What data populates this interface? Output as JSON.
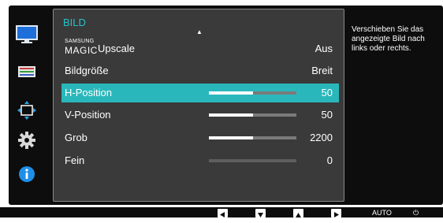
{
  "menu": {
    "title": "BILD",
    "items": [
      {
        "brand_small": "SAMSUNG",
        "brand_big": "MAGIC",
        "label": "Upscale",
        "value": "Aus"
      },
      {
        "label": "Bildgröße",
        "value": "Breit"
      },
      {
        "label": "H-Position",
        "value": "50",
        "level": 0.5,
        "selected": true
      },
      {
        "label": "V-Position",
        "value": "50",
        "level": 0.5
      },
      {
        "label": "Grob",
        "value": "2200",
        "level": 0.5
      },
      {
        "label": "Fein",
        "value": "0",
        "level": 0
      }
    ]
  },
  "sidebar": {
    "icons": [
      "monitor-icon",
      "color-bars-icon",
      "position-arrows-icon",
      "gear-icon",
      "info-icon"
    ],
    "active": "monitor-icon"
  },
  "help": {
    "text": "Verschieben Sie das angezeigte Bild nach links oder rechts."
  },
  "bottom_bar": {
    "buttons": [
      "left-arrow-icon",
      "down-arrow-icon",
      "up-arrow-icon",
      "right-arrow-icon"
    ],
    "auto_label": "AUTO",
    "power_symbol": "⏻"
  },
  "colors": {
    "accent": "#2ab7bb",
    "title": "#26c1c9",
    "panel": "#3a3a3a",
    "frame": "#0d0d0d"
  }
}
